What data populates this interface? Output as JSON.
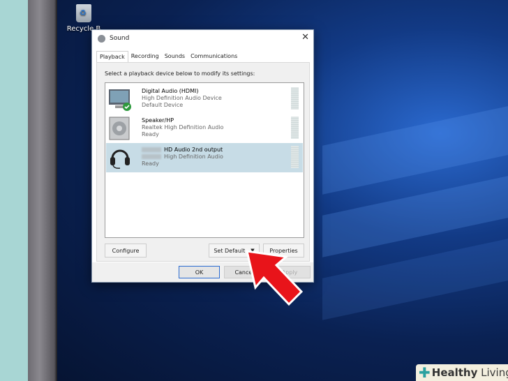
{
  "desktop": {
    "recycle_bin_label": "Recycle B"
  },
  "dialog": {
    "title": "Sound",
    "tabs": [
      "Playback",
      "Recording",
      "Sounds",
      "Communications"
    ],
    "active_tab": "Playback",
    "instruction": "Select a playback device below to modify its settings:",
    "devices": [
      {
        "name": "Digital Audio (HDMI)",
        "driver": "High Definition Audio Device",
        "status": "Default Device",
        "icon": "monitor-icon",
        "default": true
      },
      {
        "name": "Speaker/HP",
        "driver": "Realtek High Definition Audio",
        "status": "Ready",
        "icon": "speaker-icon"
      },
      {
        "name": "HD Audio 2nd output",
        "driver": "High Definition Audio",
        "status": "Ready",
        "icon": "headset-icon",
        "selected": true
      }
    ],
    "buttons": {
      "configure": "Configure",
      "set_default": "Set Default",
      "properties": "Properties",
      "ok": "OK",
      "cancel": "Cancel",
      "apply": "Apply"
    }
  },
  "watermark": {
    "brand_bold": "Healthy",
    "brand_rest": " Living"
  },
  "colors": {
    "selection": "#c7dce6",
    "arrow": "#e8141a"
  }
}
